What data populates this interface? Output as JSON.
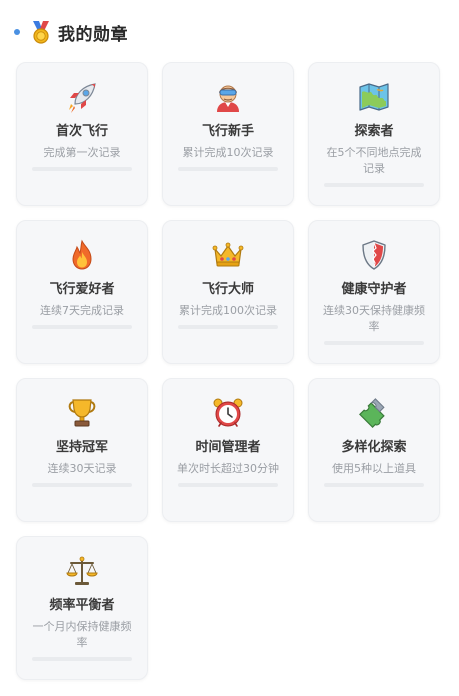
{
  "section": {
    "title": "我的勋章",
    "icon": "medal-icon",
    "accent_color": "#4a90e2"
  },
  "badges": [
    {
      "title": "首次飞行",
      "desc": "完成第一次记录",
      "icon": "rocket-icon",
      "progress": 0
    },
    {
      "title": "飞行新手",
      "desc": "累计完成10次记录",
      "icon": "pilot-icon",
      "progress": 0
    },
    {
      "title": "探索者",
      "desc": "在5个不同地点完成记录",
      "icon": "map-icon",
      "progress": 0
    },
    {
      "title": "飞行爱好者",
      "desc": "连续7天完成记录",
      "icon": "fire-icon",
      "progress": 0
    },
    {
      "title": "飞行大师",
      "desc": "累计完成100次记录",
      "icon": "crown-icon",
      "progress": 0
    },
    {
      "title": "健康守护者",
      "desc": "连续30天保持健康频率",
      "icon": "shield-icon",
      "progress": 0
    },
    {
      "title": "坚持冠军",
      "desc": "连续30天记录",
      "icon": "trophy-icon",
      "progress": 0
    },
    {
      "title": "时间管理者",
      "desc": "单次时长超过30分钟",
      "icon": "alarm-clock-icon",
      "progress": 0
    },
    {
      "title": "多样化探索",
      "desc": "使用5种以上道具",
      "icon": "puzzle-icon",
      "progress": 0
    },
    {
      "title": "频率平衡者",
      "desc": "一个月内保持健康频率",
      "icon": "balance-scale-icon",
      "progress": 0
    }
  ]
}
